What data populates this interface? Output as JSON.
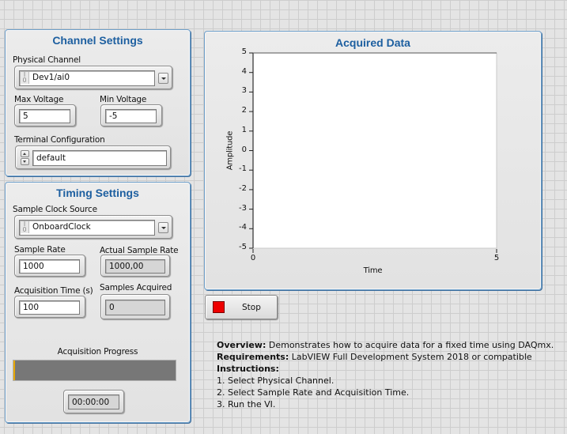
{
  "channel_settings": {
    "title": "Channel Settings",
    "physical_channel": {
      "label": "Physical Channel",
      "value": "Dev1/ai0",
      "icon": "io-name-icon"
    },
    "max_voltage": {
      "label": "Max Voltage",
      "value": "5"
    },
    "min_voltage": {
      "label": "Min Voltage",
      "value": "-5"
    },
    "terminal_configuration": {
      "label": "Terminal Configuration",
      "value": "default"
    }
  },
  "timing_settings": {
    "title": "Timing Settings",
    "sample_clock_source": {
      "label": "Sample Clock Source",
      "value": "OnboardClock",
      "icon": "io-name-icon"
    },
    "sample_rate": {
      "label": "Sample Rate",
      "value": "1000"
    },
    "actual_sample_rate": {
      "label": "Actual Sample Rate",
      "value": "1000,00"
    },
    "acquisition_time": {
      "label": "Acquisition Time (s)",
      "value": "100"
    },
    "samples_acquired": {
      "label": "Samples Acquired",
      "value": "0"
    },
    "acquisition_progress": {
      "label": "Acquisition Progress",
      "value_fraction": 0.0
    },
    "elapsed_time": "00:00:00"
  },
  "io_icon": {
    "top": "I",
    "bottom": "0"
  },
  "graph": {
    "title": "Acquired Data",
    "xlabel": "Time",
    "ylabel": "Amplitude"
  },
  "chart_data": {
    "type": "line",
    "title": "Acquired Data",
    "xlabel": "Time",
    "ylabel": "Amplitude",
    "xlim": [
      0,
      5
    ],
    "ylim": [
      -5,
      5
    ],
    "x_ticks": [
      "0",
      "5"
    ],
    "y_ticks": [
      "5",
      "4",
      "3",
      "2",
      "1",
      "0",
      "-1",
      "-2",
      "-3",
      "-4",
      "-5"
    ],
    "series": [],
    "grid": false
  },
  "stop_button": {
    "label": "Stop",
    "led_color": "#ee0000"
  },
  "description": {
    "overview_label": "Overview:",
    "overview_text": " Demonstrates how to acquire data for a fixed time using DAQmx.",
    "requirements_label": "Requirements:",
    "requirements_text": " LabVIEW Full Development System 2018 or compatible",
    "instructions_label": "Instructions:",
    "steps": [
      "1. Select Physical Channel.",
      "2. Select Sample Rate and Acquisition Time.",
      "3. Run the VI."
    ]
  }
}
